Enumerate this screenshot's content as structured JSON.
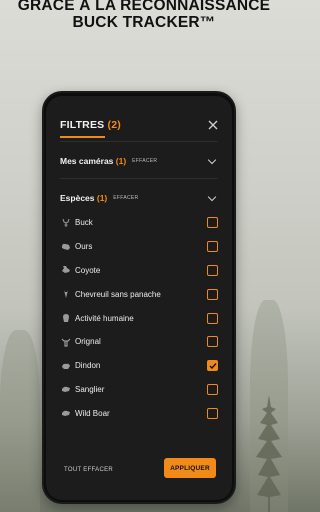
{
  "headline": {
    "line1": "GRACE À LA RECONNAISSANCE",
    "line2": "BUCK TRACKER™"
  },
  "filters": {
    "title": "FILTRES",
    "count": "(2)",
    "close_icon": "close-icon"
  },
  "cameras": {
    "title": "Mes caméras",
    "count": "(1)",
    "clear": "EFFACER",
    "expanded": false
  },
  "species": {
    "title": "Espèces",
    "count": "(1)",
    "clear": "EFFACER",
    "expanded": true,
    "items": [
      {
        "label": "Buck",
        "icon": "buck-icon",
        "checked": false
      },
      {
        "label": "Ours",
        "icon": "bear-icon",
        "checked": false
      },
      {
        "label": "Coyote",
        "icon": "coyote-icon",
        "checked": false
      },
      {
        "label": "Chevreuil sans panache",
        "icon": "doe-icon",
        "checked": false
      },
      {
        "label": "Activité humaine",
        "icon": "human-icon",
        "checked": false
      },
      {
        "label": "Orignal",
        "icon": "moose-icon",
        "checked": false
      },
      {
        "label": "Dindon",
        "icon": "turkey-icon",
        "checked": true
      },
      {
        "label": "Sanglier",
        "icon": "boar-icon",
        "checked": false
      },
      {
        "label": "Wild Boar",
        "icon": "wild-boar-icon",
        "checked": false
      }
    ]
  },
  "footer": {
    "clear_all": "TOUT EFFACER",
    "apply": "APPLIQUER"
  },
  "colors": {
    "accent": "#f28a1a",
    "panel": "#1c1c1c"
  }
}
